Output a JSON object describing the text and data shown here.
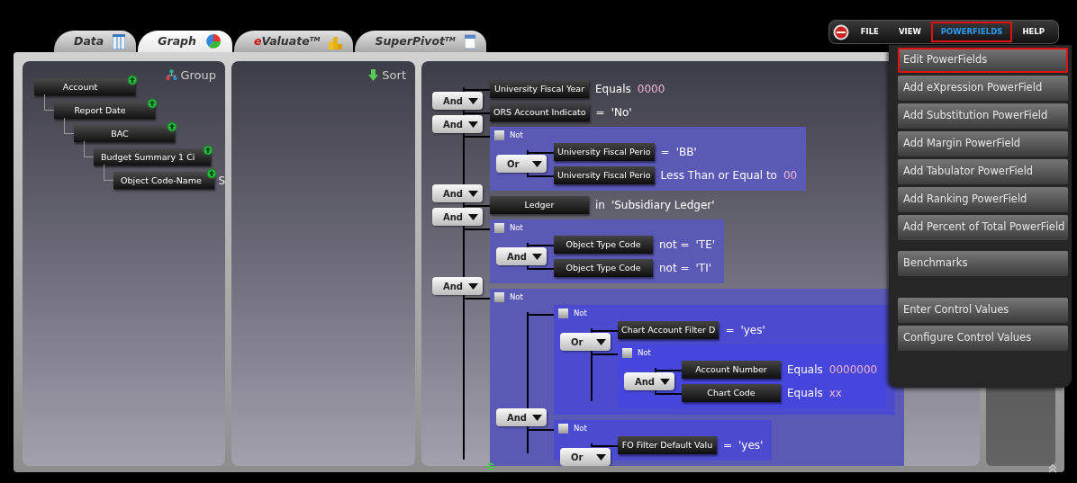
{
  "tabs": [
    {
      "label": "Data",
      "selected": false
    },
    {
      "label": "Graph",
      "selected": true
    },
    {
      "label": "eValuate$^{TM}$",
      "selected": false
    },
    {
      "label": "SuperPivot$^{TM}$",
      "selected": false
    }
  ],
  "menu_bar": {
    "items": [
      {
        "label": "FILE",
        "selected": false
      },
      {
        "label": "VIEW",
        "selected": false
      },
      {
        "label": "POWERFIELDS",
        "selected": true
      },
      {
        "label": "HELP",
        "selected": false
      }
    ]
  },
  "dropdown": {
    "sections": [
      {
        "items": [
          {
            "label": "Edit PowerFields",
            "selected": true
          },
          {
            "label": "Add eXpression PowerField",
            "selected": false
          },
          {
            "label": "Add Substitution PowerField",
            "selected": false
          },
          {
            "label": "Add Margin PowerField",
            "selected": false
          },
          {
            "label": "Add Tabulator PowerField",
            "selected": false
          },
          {
            "label": "Add Ranking PowerField",
            "selected": false
          },
          {
            "label": "Add Percent of Total PowerField",
            "selected": false
          }
        ]
      },
      {
        "items": [
          {
            "label": "Benchmarks",
            "selected": false
          }
        ]
      },
      {
        "items": [
          {
            "label": "Enter Control Values",
            "selected": false
          },
          {
            "label": "Configure Control Values",
            "selected": false
          }
        ]
      }
    ]
  },
  "group_panel": {
    "title": "Group",
    "tree": {
      "label": "Account",
      "children": [
        {
          "label": "Report Date",
          "children": [
            {
              "label": "BAC",
              "children": [
                {
                  "label": "Budget Summary 1 Ci",
                  "children": [
                    {
                      "label": "Object Code-Name",
                      "trailing_text": "S"
                    }
                  ]
                }
              ]
            }
          ]
        }
      ]
    }
  },
  "sort_panel": {
    "title": "Sort"
  },
  "filter_panel": {
    "items": [
      {
        "kind": "condition",
        "field": "University Fiscal Year",
        "comparison": "Equals",
        "value": "0000",
        "color": "#f0b4d4"
      },
      {
        "kind": "operator",
        "label": "And"
      },
      {
        "kind": "condition",
        "field": "ORS Account Indicato",
        "comparison": "=",
        "value": "'No'",
        "color": "#ffffff"
      },
      {
        "kind": "operator",
        "label": "And"
      },
      {
        "kind": "group",
        "not_label": "Not",
        "not": false,
        "items": [
          {
            "kind": "condition",
            "field": "University Fiscal Perio",
            "comparison": "=",
            "value": "'BB'",
            "color": "#ffffff"
          },
          {
            "kind": "operator",
            "label": "Or"
          },
          {
            "kind": "condition",
            "field": "University Fiscal Perio",
            "comparison": "Less Than or Equal to",
            "value": "00",
            "color": "#f0b4d4"
          }
        ]
      },
      {
        "kind": "operator",
        "label": "And"
      },
      {
        "kind": "condition",
        "field": "Ledger",
        "comparison": "in",
        "value": "'Subsidiary Ledger'",
        "color": "#ffffff"
      },
      {
        "kind": "operator",
        "label": "And"
      },
      {
        "kind": "group",
        "not_label": "Not",
        "not": false,
        "items": [
          {
            "kind": "condition",
            "field": "Object Type Code",
            "comparison": "not =",
            "value": "'TE'",
            "color": "#ffffff"
          },
          {
            "kind": "operator",
            "label": "And"
          },
          {
            "kind": "condition",
            "field": "Object Type Code",
            "comparison": "not =",
            "value": "'TI'",
            "color": "#ffffff"
          }
        ]
      },
      {
        "kind": "operator",
        "label": "And"
      },
      {
        "kind": "group",
        "not_label": "Not",
        "not": false,
        "items": [
          {
            "kind": "group",
            "not_label": "Not",
            "not": false,
            "items": [
              {
                "kind": "condition",
                "field": "Chart Account Filter D",
                "comparison": "=",
                "value": "'yes'",
                "color": "#ffffff"
              },
              {
                "kind": "operator",
                "label": "Or"
              },
              {
                "kind": "group",
                "not_label": "Not",
                "not": false,
                "items": [
                  {
                    "kind": "condition",
                    "field": "Account Number",
                    "comparison": "Equals",
                    "value": "0000000",
                    "color": "#f0b4d4"
                  },
                  {
                    "kind": "operator",
                    "label": "And"
                  },
                  {
                    "kind": "condition",
                    "field": "Chart Code",
                    "comparison": "Equals",
                    "value": "xx",
                    "color": "#f0b4d4"
                  }
                ]
              }
            ]
          },
          {
            "kind": "operator",
            "label": "And"
          },
          {
            "kind": "group",
            "not_label": "Not",
            "not": false,
            "items": [
              {
                "kind": "condition",
                "field": "FO Filter Default Valu",
                "comparison": "=",
                "value": "'yes'",
                "color": "#ffffff"
              },
              {
                "kind": "operator",
                "label": "Or"
              }
            ]
          }
        ]
      }
    ]
  }
}
